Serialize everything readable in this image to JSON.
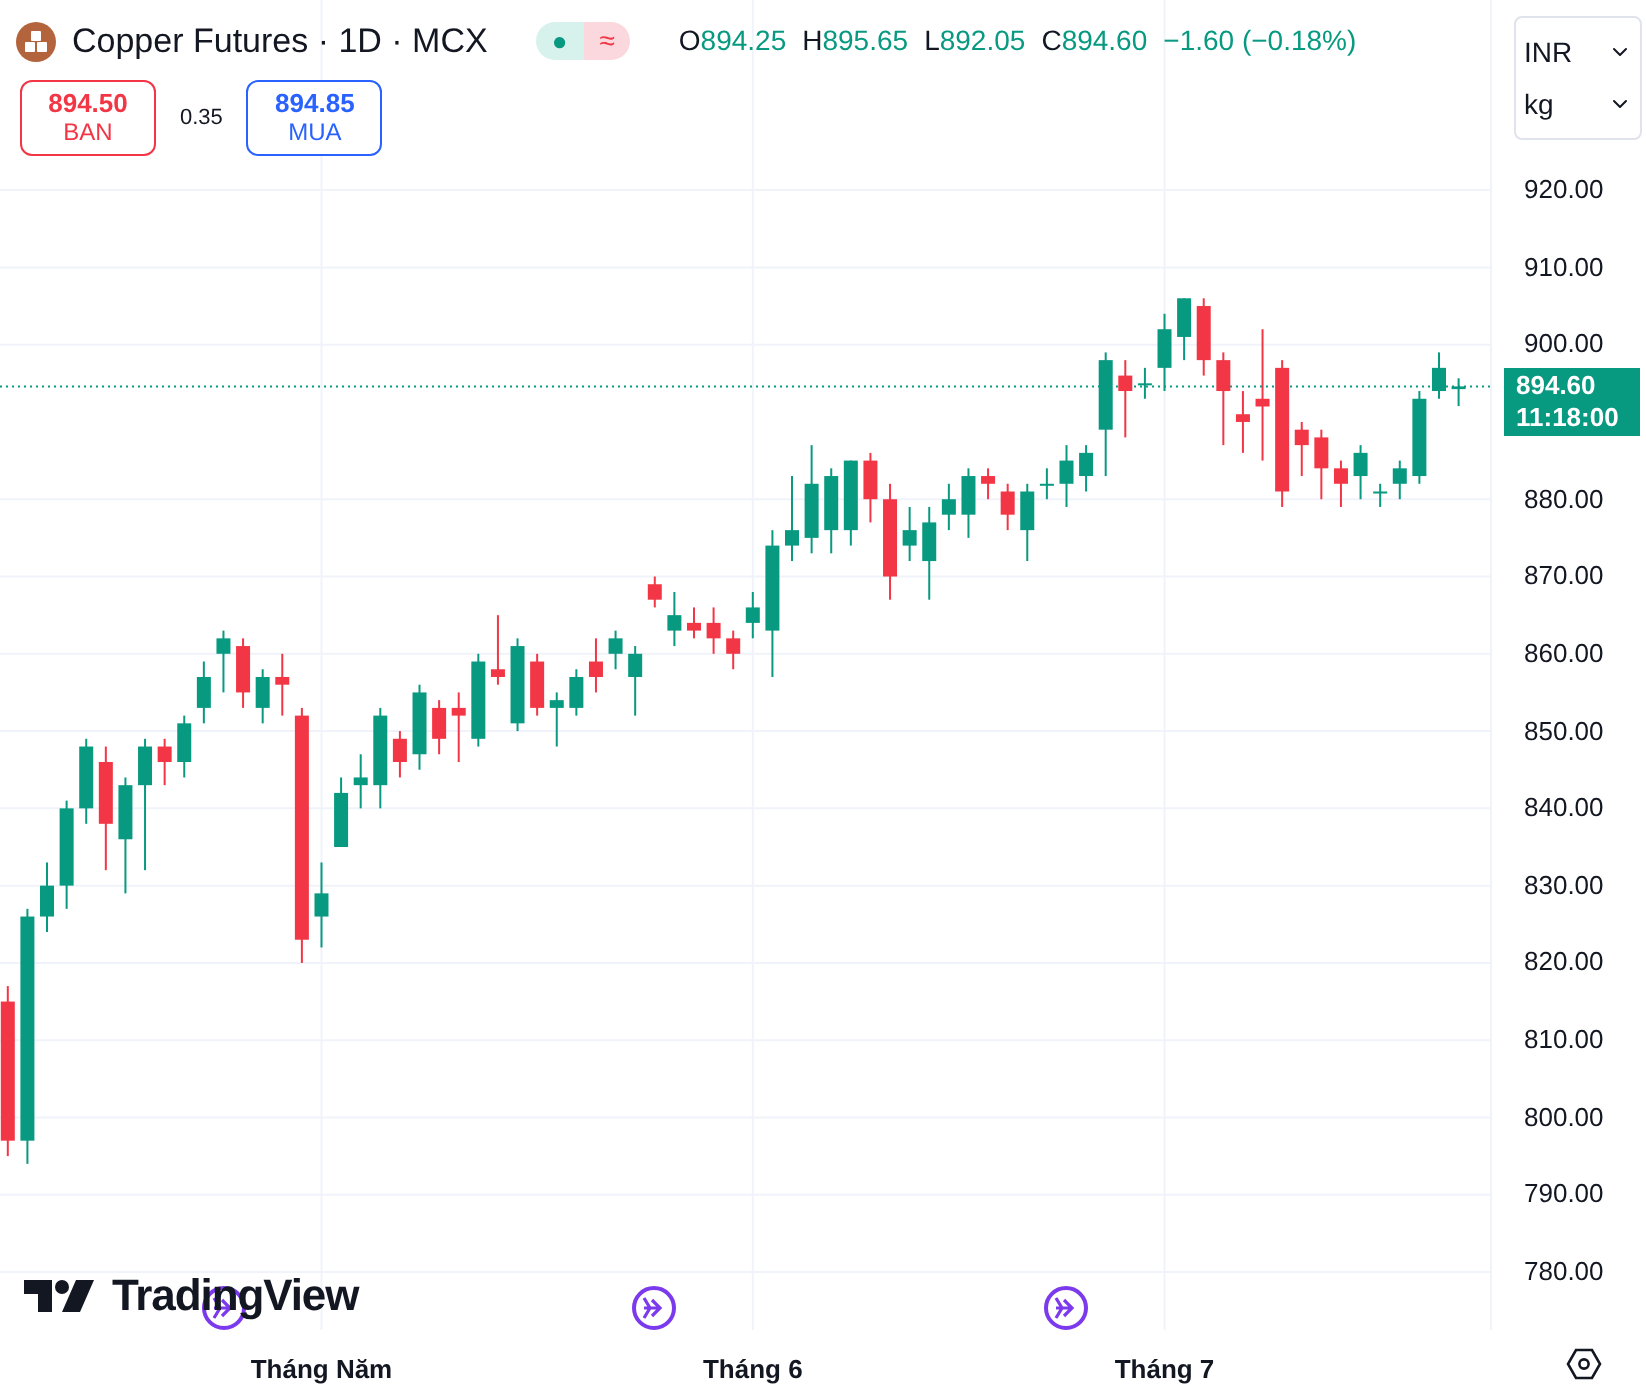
{
  "header": {
    "symbol": "Copper Futures · 1D · MCX",
    "status": "●",
    "status_alt": "≈",
    "ohlc": [
      {
        "key": "O",
        "value": "894.25"
      },
      {
        "key": "H",
        "value": "895.65"
      },
      {
        "key": "L",
        "value": "892.05"
      },
      {
        "key": "C",
        "value": "894.60"
      }
    ],
    "change": "−1.60 (−0.18%)"
  },
  "sell": {
    "price": "894.50",
    "label": "BAN"
  },
  "spread": "0.35",
  "buy": {
    "price": "894.85",
    "label": "MUA"
  },
  "selects": [
    {
      "value": "INR"
    },
    {
      "value": "kg"
    }
  ],
  "logo": "TradingView",
  "last_price": {
    "value": "894.60",
    "time": "11:18:00"
  },
  "chart_data": {
    "type": "candlestick",
    "ylim": [
      772.5,
      944.6
    ],
    "grid": true,
    "ref_lines": [
      {
        "axis": "y",
        "value": 894.6
      }
    ],
    "yticks": [
      {
        "value": 920,
        "label": "920.00"
      },
      {
        "value": 910,
        "label": "910.00"
      },
      {
        "value": 900,
        "label": "900.00"
      },
      {
        "value": 880,
        "label": "880.00"
      },
      {
        "value": 870,
        "label": "870.00"
      },
      {
        "value": 860,
        "label": "860.00"
      },
      {
        "value": 850,
        "label": "850.00"
      },
      {
        "value": 840,
        "label": "840.00"
      },
      {
        "value": 830,
        "label": "830.00"
      },
      {
        "value": 820,
        "label": "820.00"
      },
      {
        "value": 810,
        "label": "810.00"
      },
      {
        "value": 800,
        "label": "800.00"
      },
      {
        "value": 790,
        "label": "790.00"
      },
      {
        "value": 780,
        "label": "780.00"
      }
    ],
    "categories": [
      null,
      null,
      null,
      null,
      null,
      null,
      null,
      null,
      null,
      null,
      null,
      null,
      null,
      null,
      null,
      null,
      "Tháng Năm",
      null,
      null,
      null,
      null,
      null,
      null,
      null,
      null,
      null,
      null,
      null,
      null,
      null,
      null,
      null,
      null,
      null,
      null,
      null,
      null,
      null,
      "Tháng 6",
      null,
      null,
      null,
      null,
      null,
      null,
      null,
      null,
      null,
      null,
      null,
      null,
      null,
      null,
      null,
      null,
      null,
      null,
      null,
      null,
      "Tháng 7",
      null,
      null,
      null,
      null,
      null,
      null,
      null,
      null,
      null,
      null,
      null,
      null,
      null,
      null,
      null
    ],
    "ohlc": [
      [
        815,
        817,
        795,
        797
      ],
      [
        797,
        827,
        794,
        826
      ],
      [
        826,
        833,
        824,
        830
      ],
      [
        830,
        841,
        827,
        840
      ],
      [
        840,
        849,
        838,
        848
      ],
      [
        846,
        848,
        832,
        838
      ],
      [
        836,
        844,
        829,
        843
      ],
      [
        843,
        849,
        832,
        848
      ],
      [
        848,
        849,
        843,
        846
      ],
      [
        846,
        852,
        844,
        851
      ],
      [
        853,
        859,
        851,
        857
      ],
      [
        860,
        863,
        855,
        862
      ],
      [
        861,
        862,
        853,
        855
      ],
      [
        853,
        858,
        851,
        857
      ],
      [
        857,
        860,
        852,
        856
      ],
      [
        852,
        853,
        820,
        823
      ],
      [
        826,
        833,
        822,
        829
      ],
      [
        835,
        844,
        835,
        842
      ],
      [
        843,
        847,
        840,
        844
      ],
      [
        843,
        853,
        840,
        852
      ],
      [
        849,
        850,
        844,
        846
      ],
      [
        847,
        856,
        845,
        855
      ],
      [
        853,
        854,
        847,
        849
      ],
      [
        853,
        855,
        846,
        852
      ],
      [
        849,
        860,
        848,
        859
      ],
      [
        858,
        865,
        856,
        857
      ],
      [
        851,
        862,
        850,
        861
      ],
      [
        859,
        860,
        852,
        853
      ],
      [
        853,
        855,
        848,
        854
      ],
      [
        853,
        858,
        852,
        857
      ],
      [
        859,
        862,
        855,
        857
      ],
      [
        860,
        863,
        858,
        862
      ],
      [
        857,
        861,
        852,
        860
      ],
      [
        869,
        870,
        866,
        867
      ],
      [
        863,
        868,
        861,
        865
      ],
      [
        864,
        866,
        862,
        863
      ],
      [
        864,
        866,
        860,
        862
      ],
      [
        862,
        863,
        858,
        860
      ],
      [
        864,
        868,
        862,
        866
      ],
      [
        863,
        876,
        857,
        874
      ],
      [
        874,
        883,
        872,
        876
      ],
      [
        875,
        887,
        873,
        882
      ],
      [
        876,
        884,
        873,
        883
      ],
      [
        876,
        885,
        874,
        885
      ],
      [
        885,
        886,
        877,
        880
      ],
      [
        880,
        882,
        867,
        870
      ],
      [
        874,
        879,
        872,
        876
      ],
      [
        872,
        879,
        867,
        877
      ],
      [
        878,
        882,
        876,
        880
      ],
      [
        878,
        884,
        875,
        883
      ],
      [
        883,
        884,
        880,
        882
      ],
      [
        881,
        882,
        876,
        878
      ],
      [
        876,
        882,
        872,
        881
      ],
      [
        882,
        884,
        880,
        882
      ],
      [
        882,
        887,
        879,
        885
      ],
      [
        883,
        887,
        881,
        886
      ],
      [
        889,
        899,
        883,
        898
      ],
      [
        896,
        898,
        888,
        894
      ],
      [
        895,
        897,
        893,
        895
      ],
      [
        897,
        904,
        894,
        902
      ],
      [
        901,
        906,
        898,
        906
      ],
      [
        905,
        906,
        896,
        898
      ],
      [
        898,
        899,
        887,
        894
      ],
      [
        891,
        894,
        886,
        890
      ],
      [
        893,
        902,
        885,
        892
      ],
      [
        897,
        898,
        879,
        881
      ],
      [
        889,
        890,
        883,
        887
      ],
      [
        888,
        889,
        880,
        884
      ],
      [
        884,
        885,
        879,
        882
      ],
      [
        883,
        887,
        880,
        886
      ],
      [
        881,
        882,
        879,
        881
      ],
      [
        882,
        885,
        880,
        884
      ],
      [
        883,
        894,
        882,
        893
      ],
      [
        894,
        899,
        893,
        897
      ],
      [
        894.25,
        895.65,
        892.05,
        894.6
      ]
    ]
  }
}
